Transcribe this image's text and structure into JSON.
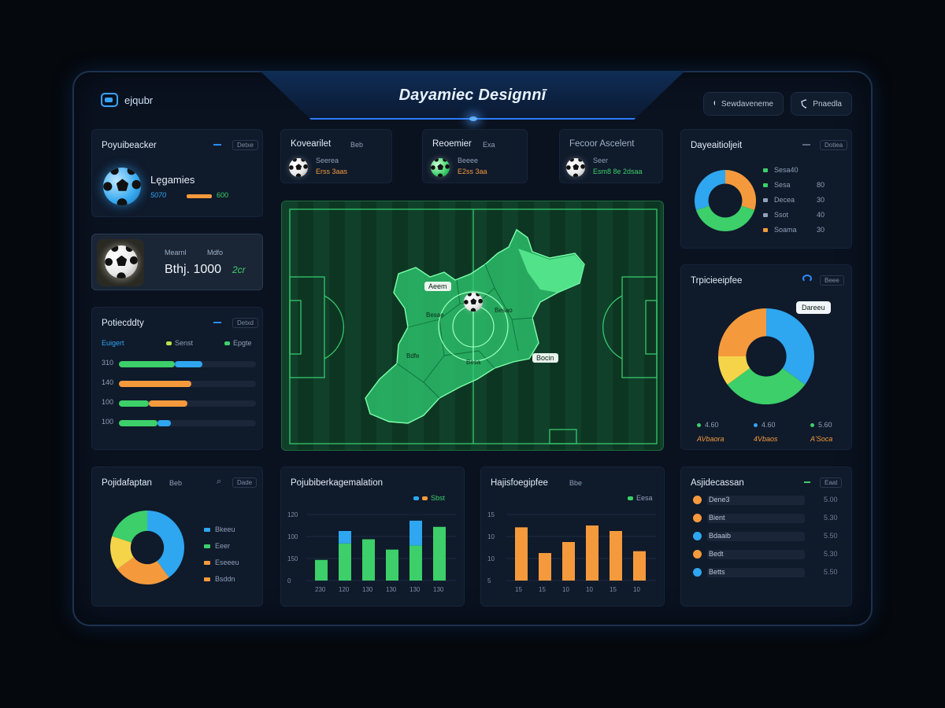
{
  "header": {
    "app_name": "ejqubr",
    "title": "Dayamiec Designnī",
    "search_label": "Sewdaveneme",
    "profile_label": "Pnaedla"
  },
  "cards": {
    "popular": {
      "title": "Poyuibeacker",
      "tag": "Detxe",
      "name": "Lęgamies",
      "stat": "5070",
      "value": "600"
    },
    "featured": {
      "label_a": "Mearnl",
      "label_b": "Mdfo",
      "value": "Bthj. 1000",
      "suffix": "2cr"
    },
    "productivity": {
      "title": "Potiecddty",
      "tag": "Detxd",
      "legend": [
        "Euigert",
        "Senst",
        "Epgte"
      ],
      "rows": [
        {
          "label": "310",
          "green": 0.41,
          "blue": 0.2,
          "orange": 0
        },
        {
          "label": "140",
          "green": 0,
          "blue": 0,
          "orange": 0.53
        },
        {
          "label": "100",
          "green": 0.22,
          "blue": 0,
          "orange": 0.28
        },
        {
          "label": "100",
          "green": 0.28,
          "blue": 0.1,
          "orange": 0
        }
      ]
    },
    "stat1": {
      "title": "Kovearilet",
      "tag": "Beb",
      "l1": "Seerea",
      "l2": "Erss 3aas"
    },
    "stat2": {
      "title": "Reoemier",
      "tag": "Exa",
      "l1": "Beeee",
      "l2": "E2ss 3aa"
    },
    "stat3": {
      "title": "Fecoor Ascelent",
      "l1": "Seer",
      "l2": "Esm8 8e 2dsaa"
    },
    "dynamic": {
      "title": "Dayeaitioljeit",
      "tag": "Dotiea",
      "legend": [
        {
          "label": "Sesa40",
          "value": ""
        },
        {
          "label": "Sesa",
          "value": "80"
        },
        {
          "label": "Decea",
          "value": "30"
        },
        {
          "label": "Ssot",
          "value": "40"
        },
        {
          "label": "Soama",
          "value": "30"
        }
      ]
    },
    "typical": {
      "title": "Trpicieeipfee",
      "tag": "Beee",
      "tooltip": "Dareeu",
      "legend": [
        {
          "label": "4.60",
          "sub": "AVbaora"
        },
        {
          "label": "4.60",
          "sub": "4Vbaos"
        },
        {
          "label": "5.60",
          "sub": "A'Soca"
        }
      ]
    },
    "distribution": {
      "title": "Pojidafaptan",
      "tag": "Dade",
      "badge": "Beb",
      "legend": [
        "Bkeeu",
        "Eeer",
        "Eseeeu",
        "Bsddn"
      ]
    },
    "performance_bar": {
      "title": "Pojubiberkagemalation",
      "legend": "Sbst",
      "yticks": [
        "120",
        "100",
        "150",
        "0"
      ],
      "xticks": [
        "230",
        "120",
        "130",
        "130",
        "130",
        "130"
      ]
    },
    "highlights": {
      "title": "Hajisfoegipfee",
      "badge": "Bbe",
      "legend": "Eesa",
      "yticks": [
        "15",
        "10",
        "10",
        "5"
      ],
      "xticks": [
        "15",
        "15",
        "10",
        "10",
        "15",
        "10"
      ]
    },
    "players": {
      "title": "Asjidecassan",
      "tag": "Eaat",
      "rows": [
        {
          "name": "Dene3",
          "value": "5.00"
        },
        {
          "name": "Bient",
          "value": "5.30"
        },
        {
          "name": "Bdaaib",
          "value": "5.50"
        },
        {
          "name": "Bedt",
          "value": "5.30"
        },
        {
          "name": "Betts",
          "value": "5.50"
        }
      ]
    }
  },
  "pitch": {
    "labels": [
      "Aeem",
      "Besae",
      "Besao",
      "Bdfe",
      "Besa",
      "Bocin"
    ]
  },
  "chart_data": [
    {
      "type": "pie",
      "title": "Dayeaitioljeit",
      "values": [
        30,
        40,
        30
      ],
      "colors": [
        "#f59a3c",
        "#3ccf6a",
        "#2ea6f0"
      ]
    },
    {
      "type": "pie",
      "title": "Trpicieeipfee",
      "values": [
        35,
        30,
        10,
        25
      ],
      "colors": [
        "#2ea6f0",
        "#3ccf6a",
        "#f5d44a",
        "#f59a3c"
      ]
    },
    {
      "type": "pie",
      "title": "Pojidafaptan",
      "values": [
        40,
        25,
        15,
        20
      ],
      "colors": [
        "#2ea6f0",
        "#f59a3c",
        "#f5d44a",
        "#3ccf6a"
      ]
    },
    {
      "type": "bar",
      "title": "Pojubiberkagemalation",
      "categories": [
        "230",
        "120",
        "130",
        "130",
        "130",
        "130"
      ],
      "series": [
        {
          "name": "",
          "values": [
            50,
            90,
            100,
            75,
            85,
            130
          ]
        },
        {
          "name": "",
          "values": [
            0,
            30,
            0,
            0,
            60,
            0
          ]
        }
      ],
      "ylim": [
        0,
        160
      ]
    },
    {
      "type": "bar",
      "title": "Hajisfoegipfee",
      "categories": [
        "15",
        "15",
        "10",
        "10",
        "15",
        "10"
      ],
      "values": [
        14.5,
        7.5,
        10.5,
        15,
        13.5,
        8
      ],
      "ylim": [
        0,
        18
      ]
    }
  ]
}
